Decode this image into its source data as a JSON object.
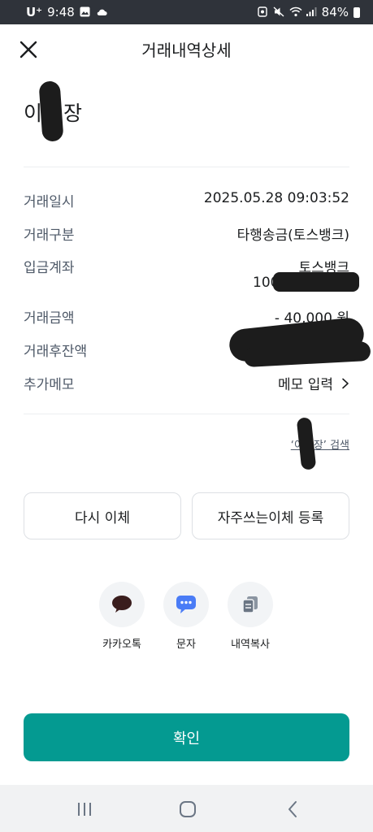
{
  "status_bar": {
    "carrier": "U⁺",
    "time": "9:48",
    "battery": "84%"
  },
  "header": {
    "title": "거래내역상세"
  },
  "recipient": {
    "name_prefix": "이",
    "name_suffix": "장"
  },
  "details": [
    {
      "label": "거래일시",
      "value": "2025.05.28 09:03:52"
    },
    {
      "label": "거래구분",
      "value": "타행송금(토스뱅크)"
    },
    {
      "label": "입금계좌",
      "value": "토스뱅크",
      "value_line2": "1001"
    },
    {
      "label": "거래금액",
      "value": "- 40,000 원"
    },
    {
      "label": "거래후잔액",
      "value": ""
    },
    {
      "label": "추가메모",
      "value": "메모 입력"
    }
  ],
  "search_link": {
    "prefix": "‘이",
    "suffix": "장’ 검색"
  },
  "buttons": {
    "retransfer": "다시 이체",
    "register_frequent": "자주쓰는이체 등록",
    "confirm": "확인"
  },
  "share": [
    {
      "label": "카카오톡",
      "icon": "speech-bubble-icon"
    },
    {
      "label": "문자",
      "icon": "message-icon"
    },
    {
      "label": "내역복사",
      "icon": "copy-icon"
    }
  ],
  "colors": {
    "accent": "#049a91",
    "status_bar": "#2f333a"
  }
}
